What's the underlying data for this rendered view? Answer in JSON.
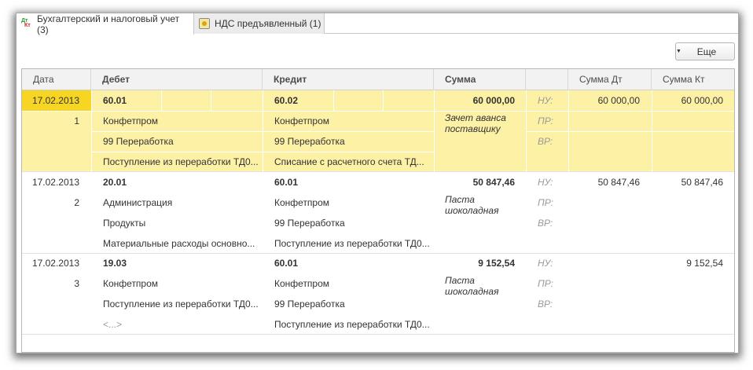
{
  "tabs": [
    {
      "label": "Бухгалтерский и налоговый учет (3)",
      "icon": "dt-kt-icon",
      "active": true
    },
    {
      "label": "НДС предъявленный (1)",
      "icon": "vat-icon",
      "active": false
    }
  ],
  "toolbar": {
    "more_label": "Еще"
  },
  "table": {
    "columns": [
      "Дата",
      "Дебет",
      "Кредит",
      "Сумма",
      "",
      "Сумма Дт",
      "Сумма Кт"
    ],
    "rows": [
      {
        "date": "17.02.2013",
        "number": "1",
        "selected": true,
        "debit": [
          "60.01",
          "Конфетпром",
          "99 Переработка",
          "Поступление из переработки ТД0..."
        ],
        "credit": [
          "60.02",
          "Конфетпром",
          "99 Переработка",
          "Списание с расчетного счета ТД..."
        ],
        "sum": "60 000,00",
        "content": "Зачет аванса поставщику",
        "labels": [
          "НУ:",
          "ПР:",
          "ВР:"
        ],
        "sum_dt": "60 000,00",
        "sum_kt": "60 000,00"
      },
      {
        "date": "17.02.2013",
        "number": "2",
        "selected": false,
        "debit": [
          "20.01",
          "Администрация",
          "Продукты",
          "Материальные расходы основно..."
        ],
        "credit": [
          "60.01",
          "Конфетпром",
          "99 Переработка",
          "Поступление из переработки ТД0..."
        ],
        "sum": "50 847,46",
        "content": "Паста шоколадная",
        "labels": [
          "НУ:",
          "ПР:",
          "ВР:"
        ],
        "sum_dt": "50 847,46",
        "sum_kt": "50 847,46"
      },
      {
        "date": "17.02.2013",
        "number": "3",
        "selected": false,
        "debit": [
          "19.03",
          "Конфетпром",
          "Поступление из переработки ТД0...",
          "<...>"
        ],
        "credit": [
          "60.01",
          "Конфетпром",
          "99 Переработка",
          "Поступление из переработки ТД0..."
        ],
        "sum": "9 152,54",
        "content": "Паста шоколадная",
        "labels": [
          "НУ:",
          "ПР:",
          "ВР:"
        ],
        "sum_dt": "",
        "sum_kt": "9 152,54"
      }
    ]
  },
  "colors": {
    "selected_row": "#fdf1a6",
    "selected_cell": "#f7d523"
  }
}
